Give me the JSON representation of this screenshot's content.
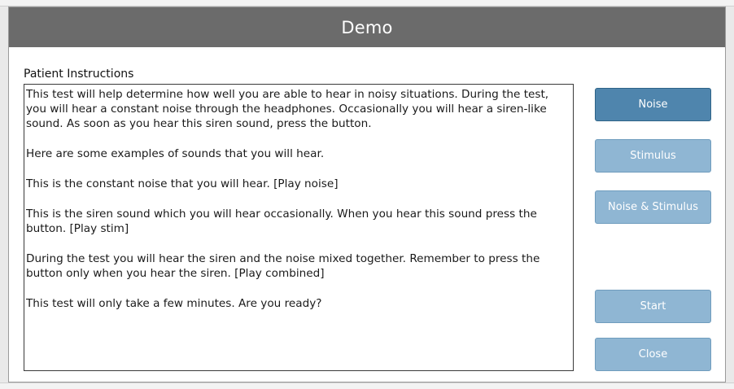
{
  "dialog": {
    "title": "Demo"
  },
  "instructions": {
    "label": "Patient Instructions",
    "paragraphs": [
      "This test will help determine how well you are able to hear in noisy situations. During the test, you will hear a constant noise through the headphones.  Occasionally you will hear a siren-like sound.  As soon as you hear this siren sound, press the button.",
      "Here are some examples of sounds that you will hear.",
      "This is the constant noise that you will hear.   [Play noise]",
      "This is the siren sound which you will hear occasionally.  When you hear this sound press the button. [Play stim]",
      "During the test you will hear the siren and the noise mixed together.  Remember to press the button only when you hear the siren. [Play combined]",
      "This test will only take a few minutes. Are you ready?"
    ]
  },
  "buttons": {
    "noise": "Noise",
    "stimulus": "Stimulus",
    "noise_stimulus": "Noise & Stimulus",
    "start": "Start",
    "close": "Close"
  },
  "colors": {
    "titlebar": "#6b6b6b",
    "button_active": "#4f85ad",
    "button_dim": "#8fb6d3"
  }
}
